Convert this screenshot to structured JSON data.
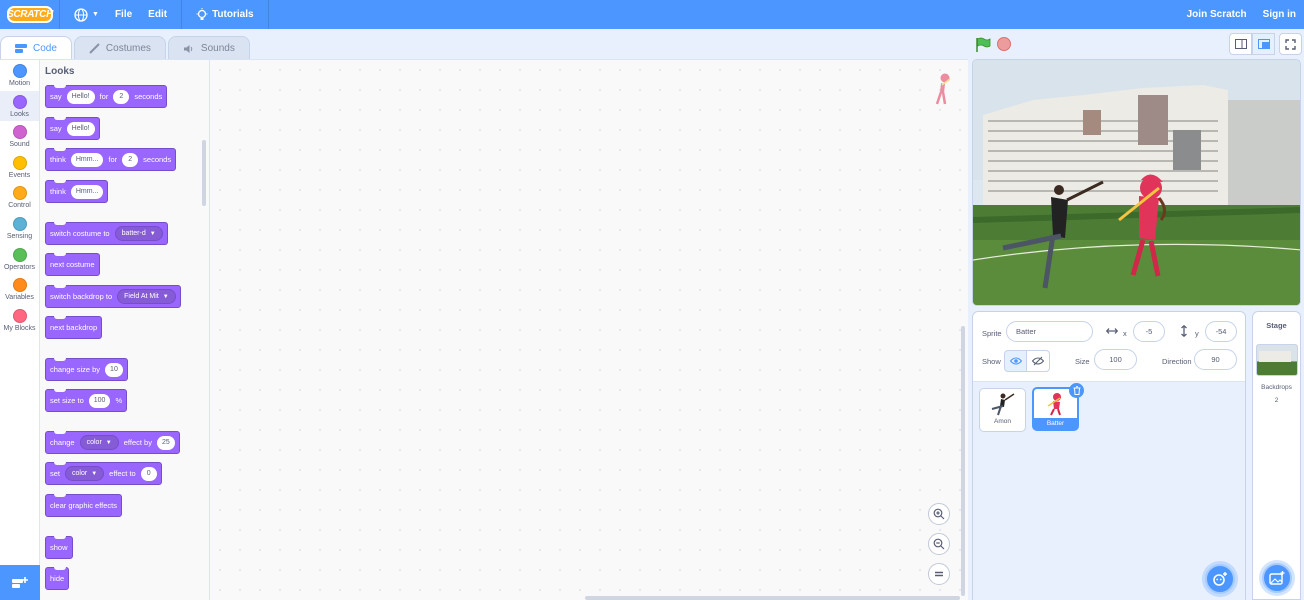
{
  "menubar": {
    "logo": "SCRATCH",
    "file": "File",
    "edit": "Edit",
    "tutorials": "Tutorials",
    "join": "Join Scratch",
    "signin": "Sign in"
  },
  "tabs": {
    "code": "Code",
    "costumes": "Costumes",
    "sounds": "Sounds"
  },
  "categories": [
    {
      "label": "Motion",
      "color": "#4c97ff"
    },
    {
      "label": "Looks",
      "color": "#9966ff"
    },
    {
      "label": "Sound",
      "color": "#cf63cf"
    },
    {
      "label": "Events",
      "color": "#ffbf00"
    },
    {
      "label": "Control",
      "color": "#ffab19"
    },
    {
      "label": "Sensing",
      "color": "#5cb1d6"
    },
    {
      "label": "Operators",
      "color": "#59c059"
    },
    {
      "label": "Variables",
      "color": "#ff8c1a"
    },
    {
      "label": "My Blocks",
      "color": "#ff6680"
    }
  ],
  "palette": {
    "title": "Looks",
    "say_for": {
      "say": "say",
      "msg": "Hello!",
      "for": "for",
      "secs": "2",
      "seconds": "seconds"
    },
    "say": {
      "say": "say",
      "msg": "Hello!"
    },
    "think_for": {
      "think": "think",
      "msg": "Hmm...",
      "for": "for",
      "secs": "2",
      "seconds": "seconds"
    },
    "think": {
      "think": "think",
      "msg": "Hmm..."
    },
    "switch_costume": {
      "label": "switch costume to",
      "value": "batter-d"
    },
    "next_costume": "next costume",
    "switch_backdrop": {
      "label": "switch backdrop to",
      "value": "Field At Mit"
    },
    "next_backdrop": "next backdrop",
    "change_size": {
      "label": "change size by",
      "value": "10"
    },
    "set_size": {
      "label": "set size to",
      "value": "100",
      "unit": "%"
    },
    "change_effect": {
      "change": "change",
      "effect": "color",
      "by": "effect by",
      "value": "25"
    },
    "set_effect": {
      "set": "set",
      "effect": "color",
      "to": "effect to",
      "value": "0"
    },
    "clear_effects": "clear graphic effects",
    "show": "show",
    "hide": "hide"
  },
  "sprite_info": {
    "sprite_label": "Sprite",
    "sprite_name": "Batter",
    "x_label": "x",
    "x_value": "-5",
    "y_label": "y",
    "y_value": "-54",
    "show_label": "Show",
    "size_label": "Size",
    "size_value": "100",
    "direction_label": "Direction",
    "direction_value": "90"
  },
  "sprites": [
    {
      "name": "Amon",
      "selected": false
    },
    {
      "name": "Batter",
      "selected": true
    }
  ],
  "stage_pane": {
    "title": "Stage",
    "backdrops_label": "Backdrops",
    "backdrops_count": "2"
  }
}
